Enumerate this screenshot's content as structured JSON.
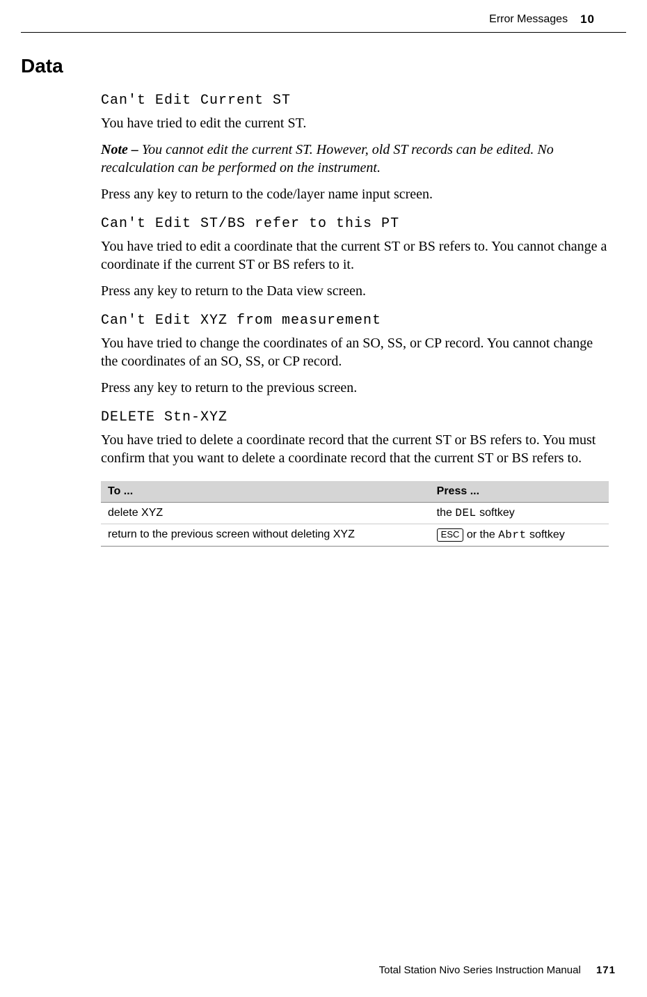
{
  "header": {
    "title": "Error Messages",
    "chapter": "10"
  },
  "sectionHeading": "Data",
  "entries": [
    {
      "lcd": "Can't Edit Current ST",
      "body1": "You have tried to edit the current ST.",
      "noteLabel": "Note – ",
      "note": "You cannot edit the current ST. However, old ST records can be edited. No recalculation can be performed on the instrument.",
      "body2": "Press any key to return to the code/layer name input screen."
    },
    {
      "lcd": "Can't Edit ST/BS refer to this PT",
      "body1": "You have tried to edit a coordinate that the current ST or BS refers to. You cannot change a coordinate if the current ST or BS refers to it.",
      "body2": "Press any key to return to the Data view screen."
    },
    {
      "lcd": "Can't Edit XYZ from measurement",
      "body1": "You have tried to change the coordinates of an SO, SS, or CP record. You cannot change the coordinates of an SO, SS, or CP record.",
      "body2": "Press any key to return to the previous screen."
    },
    {
      "lcd": "DELETE Stn-XYZ",
      "body1": "You have tried to delete a coordinate record that the current ST or BS refers to. You must confirm that you want to delete a coordinate record that the current ST or BS refers to."
    }
  ],
  "table": {
    "headers": {
      "col1": "To ...",
      "col2": "Press ..."
    },
    "rows": [
      {
        "action": "delete XYZ",
        "press_prefix": "the ",
        "press_lcd": "DEL",
        "press_suffix": " softkey"
      },
      {
        "action": "return to the previous screen without deleting XYZ",
        "press_key": "ESC",
        "press_mid": " or the ",
        "press_lcd": "Abrt",
        "press_suffix": " softkey"
      }
    ]
  },
  "footer": {
    "manual": "Total Station Nivo Series Instruction Manual",
    "page": "171"
  }
}
